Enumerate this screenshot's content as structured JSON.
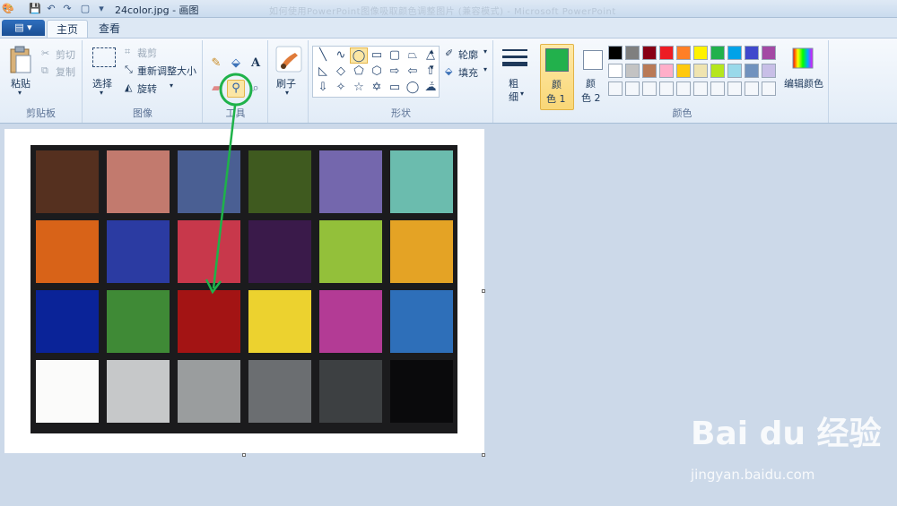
{
  "titlebar": {
    "doc_title": "24color.jpg - 画图",
    "faded_title": "如何使用PowerPoint图像吸取颜色调整图片 (兼容模式) - Microsoft PowerPoint"
  },
  "tabs": [
    {
      "label": "主页"
    },
    {
      "label": "查看"
    }
  ],
  "file_menu": {
    "glyph": "▤ ▾"
  },
  "ribbon": {
    "clipboard": {
      "label": "剪贴板",
      "paste": "粘贴",
      "cut": "剪切",
      "copy": "复制"
    },
    "image": {
      "label": "图像",
      "select": "选择",
      "crop": "裁剪",
      "resize": "重新调整大小",
      "rotate": "旋转"
    },
    "tools": {
      "label": "工具"
    },
    "brushes": {
      "label": "刷子"
    },
    "shapes": {
      "label": "形状",
      "outline": "轮廓",
      "fill": "填充"
    },
    "size": {
      "label_line1": "粗",
      "label_line2": "细"
    },
    "colors": {
      "label": "颜色",
      "color1_line1": "颜",
      "color1_line2": "色 1",
      "color2_line1": "颜",
      "color2_line2": "色 2",
      "edit_colors": "编辑颜色",
      "color1_value": "#22b14c",
      "color2_value": "#ffffff",
      "palette_row1": [
        "#000000",
        "#7f7f7f",
        "#880015",
        "#ed1c24",
        "#ff7f27",
        "#fff200",
        "#22b14c",
        "#00a2e8",
        "#3f48cc",
        "#a349a4"
      ],
      "palette_row2": [
        "#ffffff",
        "#c3c3c3",
        "#b97a57",
        "#ffaec9",
        "#ffc90e",
        "#efe4b0",
        "#b5e61d",
        "#99d9ea",
        "#7092be",
        "#c8bfe7"
      ]
    }
  },
  "canvas": {
    "color_patches": [
      [
        "#55301f",
        "#c27a6e",
        "#4a5f93",
        "#3f5a1f",
        "#7467ad",
        "#6bbcae"
      ],
      [
        "#d86318",
        "#2b3ba2",
        "#c8384b",
        "#3a1a4a",
        "#93c03a",
        "#e4a325"
      ],
      [
        "#0a2398",
        "#3f8a36",
        "#a31414",
        "#ecd22f",
        "#b33b95",
        "#2e6fb9"
      ],
      [
        "#fbfbfa",
        "#c6c8c9",
        "#9a9d9e",
        "#6b6e71",
        "#3d4042",
        "#0a0a0c"
      ]
    ]
  },
  "watermark": {
    "brand": "Bai du 经验",
    "url": "jingyan.baidu.com"
  }
}
